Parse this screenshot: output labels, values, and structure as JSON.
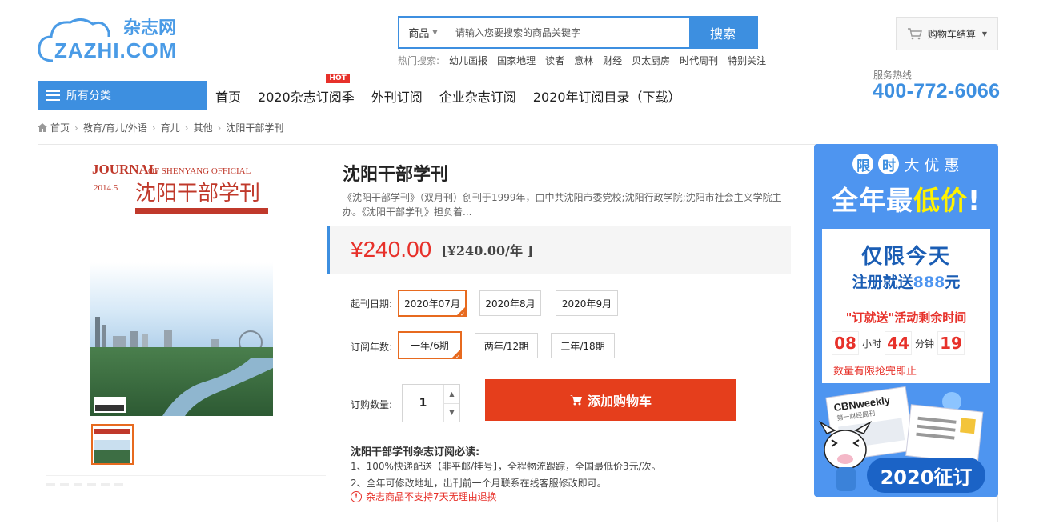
{
  "header": {
    "logo_cn": "杂志网",
    "logo_en": "ZAZHI.COM",
    "search": {
      "category": "商品",
      "placeholder": "请输入您要搜索的商品关键字",
      "button": "搜索"
    },
    "hot_search": {
      "label": "热门搜索:",
      "items": [
        "幼儿画报",
        "国家地理",
        "读者",
        "意林",
        "财经",
        "贝太厨房",
        "时代周刊",
        "特别关注"
      ]
    },
    "cart_label": "购物车结算",
    "hotline_label": "服务热线",
    "hotline_number": "400-772-6066"
  },
  "nav": {
    "all_categories": "所有分类",
    "links": [
      "首页",
      "2020杂志订阅季",
      "外刊订阅",
      "企业杂志订阅",
      "2020年订阅目录（下载）"
    ],
    "hot_badge": "HOT"
  },
  "breadcrumb": [
    "首页",
    "教育/育儿/外语",
    "育儿",
    "其他",
    "沈阳干部学刊"
  ],
  "product": {
    "cover": {
      "journal_word": "JOURNAL",
      "journal_sub": "OF SHENYANG OFFICIAL",
      "issue": "2014.5",
      "title": "沈阳干部学刊"
    },
    "title": "沈阳干部学刊",
    "description": "《沈阳干部学刊》（双月刊）创刊于1999年，由中共沈阳市委党校;沈阳行政学院;沈阳市社会主义学院主办。《沈阳干部学刊》担负着...",
    "price": "¥240.00",
    "price_per_year": "[¥240.00/年 ]",
    "start_date_label": "起刊日期:",
    "start_dates": [
      "2020年07月",
      "2020年8月",
      "2020年9月"
    ],
    "period_label": "订阅年数:",
    "periods": [
      "一年/6期",
      "两年/12期",
      "三年/18期"
    ],
    "qty_label": "订购数量:",
    "qty": "1",
    "add_cart": "添加购物车",
    "notice_title": "沈阳干部学刊杂志订阅必读:",
    "notice_1": "1、100%快递配送【非平邮/挂号】，全程物流跟踪，全国最低价3元/次。",
    "notice_2": "2、全年可修改地址，出刊前一个月联系在线客服修改即可。",
    "warning": "杂志商品不支持7天无理由退换"
  },
  "promo": {
    "top_chars": [
      "限",
      "时",
      "大",
      "优",
      "惠"
    ],
    "big_a": "全年最",
    "big_b": "低价",
    "big_c": "!",
    "only_today": "仅限今天",
    "register_a": "注册就送",
    "register_b": "888",
    "register_c": "元",
    "event_text": "\"订就送\"活动剩余时间",
    "hours": "08",
    "hours_unit": "小时",
    "minutes": "44",
    "minutes_unit": "分钟",
    "seconds": "19",
    "limited": "数量有限抢完即止",
    "magazine": "CBNweekly",
    "magazine_sub": "第一财经周刊",
    "button": "2020征订"
  },
  "colors": {
    "brand_blue": "#3d8fe0",
    "price_red": "#e7312a",
    "cart_red": "#e53e1c",
    "select_orange": "#e76a1f"
  }
}
